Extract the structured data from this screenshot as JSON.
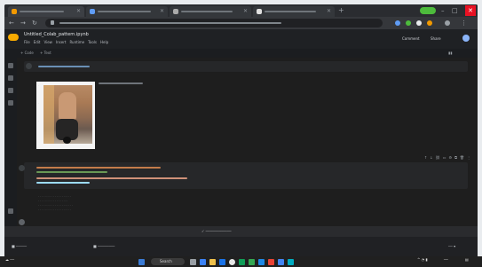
{
  "notebook": {
    "title": "Untitled_Colab_pattern.ipynb"
  },
  "menu": [
    "File",
    "Edit",
    "View",
    "Insert",
    "Runtime",
    "Tools",
    "Help"
  ],
  "header_buttons": {
    "comment": "Comment",
    "share": "Share"
  },
  "toolbar": {
    "code": "+ Code",
    "text": "+ Text"
  },
  "output_lines": [
    "· · · · · · · · · · · · · · · · · · · ·",
    "· · · · · · · · · · · · · · · · · ·",
    "· · · · · · · · · · · · · · · · · · · · ·",
    "· · · · · · · · · · · · · · · · · · · ·"
  ],
  "taskbar": {
    "search": "Search"
  },
  "colors": {
    "colab_orange": "#f9ab00",
    "close_red": "#e81123",
    "badge_green": "#4dbb3c"
  },
  "icons": [
    "back-arrow-icon",
    "forward-arrow-icon",
    "reload-icon",
    "lock-icon",
    "colab-logo-icon",
    "run-cell-icon",
    "windows-start-icon",
    "search-icon"
  ]
}
